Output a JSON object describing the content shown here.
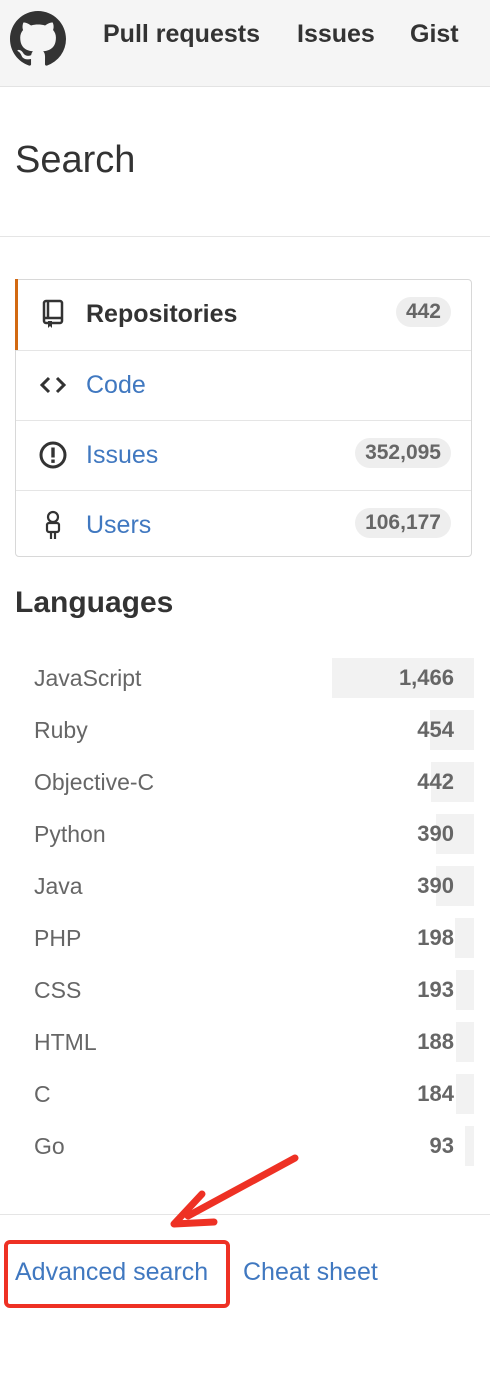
{
  "colors": {
    "link": "#4078c0",
    "accent_selected": "#d26911",
    "annotation": "#ee3124",
    "header_bg": "#f5f5f5"
  },
  "header": {
    "logo_icon": "github-octocat-icon",
    "nav": [
      {
        "label": "Pull requests"
      },
      {
        "label": "Issues"
      },
      {
        "label": "Gist"
      }
    ]
  },
  "page": {
    "title": "Search"
  },
  "search_types": [
    {
      "label": "Repositories",
      "count": "442",
      "icon": "repo-icon",
      "selected": true
    },
    {
      "label": "Code",
      "count": "",
      "icon": "code-icon",
      "selected": false
    },
    {
      "label": "Issues",
      "count": "352,095",
      "icon": "issue-icon",
      "selected": false
    },
    {
      "label": "Users",
      "count": "106,177",
      "icon": "person-icon",
      "selected": false
    }
  ],
  "languages": {
    "heading": "Languages",
    "items": [
      {
        "name": "JavaScript",
        "count": "1,466",
        "share": 1.0
      },
      {
        "name": "Ruby",
        "count": "454",
        "share": 0.31
      },
      {
        "name": "Objective-C",
        "count": "442",
        "share": 0.3
      },
      {
        "name": "Python",
        "count": "390",
        "share": 0.27
      },
      {
        "name": "Java",
        "count": "390",
        "share": 0.27
      },
      {
        "name": "PHP",
        "count": "198",
        "share": 0.135
      },
      {
        "name": "CSS",
        "count": "193",
        "share": 0.13
      },
      {
        "name": "HTML",
        "count": "188",
        "share": 0.13
      },
      {
        "name": "C",
        "count": "184",
        "share": 0.125
      },
      {
        "name": "Go",
        "count": "93",
        "share": 0.063
      }
    ]
  },
  "footer": {
    "advanced_search": "Advanced search",
    "cheat_sheet": "Cheat sheet"
  },
  "annotation": {
    "highlight_target": "advanced-search-link",
    "arrow_icon": "red-arrow-icon"
  }
}
